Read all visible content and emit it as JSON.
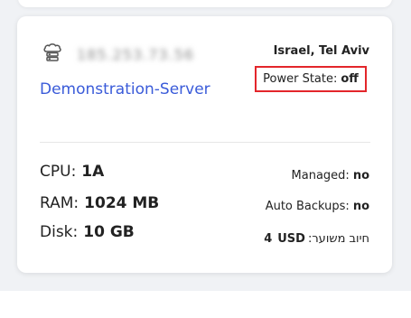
{
  "server": {
    "ip_text": "185.253.73.56",
    "name": "Demonstration-Server",
    "location": "Israel, Tel Aviv",
    "power_label": "Power State:",
    "power_value": "off"
  },
  "specs": {
    "cpu_label": "CPU:",
    "cpu_value": "1A",
    "ram_label": "RAM:",
    "ram_value": "1024 MB",
    "disk_label": "Disk:",
    "disk_value": "10 GB"
  },
  "meta": {
    "managed_label": "Managed:",
    "managed_value": "no",
    "backups_label": "Auto Backups:",
    "backups_value": "no",
    "price_label": "חיוב משוער:",
    "price_amount": "4",
    "price_currency": "USD"
  },
  "colors": {
    "link": "#3a5bd9",
    "highlight_border": "#e3262b"
  },
  "icons": {
    "server_icon": "cloud-server-icon"
  }
}
